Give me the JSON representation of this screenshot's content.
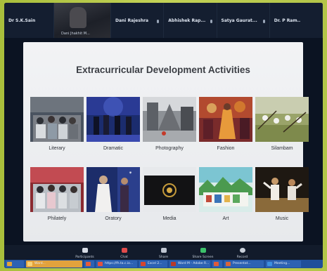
{
  "participants": [
    {
      "name": "Dr S.K.Sain",
      "sub": ""
    },
    {
      "name": "",
      "sub": "Dani Jhakhit M..."
    },
    {
      "name": "Dani Rajeshra",
      "sub": ""
    },
    {
      "name": "Abhishek Rap...",
      "sub": ""
    },
    {
      "name": "Satya Gaurat...",
      "sub": ""
    },
    {
      "name": "Dr. P Ram..",
      "sub": ""
    }
  ],
  "slide": {
    "title": "Extracurricular Development Activities",
    "activities": [
      {
        "label": "Literary"
      },
      {
        "label": "Dramatic"
      },
      {
        "label": "Photography"
      },
      {
        "label": "Fashion"
      },
      {
        "label": "Silambam"
      },
      {
        "label": "Philately"
      },
      {
        "label": "Oratory"
      },
      {
        "label": "Media"
      },
      {
        "label": "Art"
      },
      {
        "label": "Music"
      }
    ]
  },
  "toolbar": [
    {
      "label": "Participants",
      "icon": "participants-icon",
      "color": "#d7dce4"
    },
    {
      "label": "Chat",
      "icon": "chat-icon",
      "color": "#e04b4b"
    },
    {
      "label": "Share",
      "icon": "share-icon",
      "color": "#bfc6d1"
    },
    {
      "label": "Share Screen",
      "icon": "share-screen-icon",
      "color": "#3cc16a"
    },
    {
      "label": "Record",
      "icon": "record-icon",
      "color": "#c9d0da"
    }
  ],
  "taskbar": [
    {
      "label": "",
      "icon": "start-icon",
      "color": "#e0a23a"
    },
    {
      "label": "Ward...",
      "icon": "window-icon",
      "color": "#f0b84a"
    },
    {
      "label": "",
      "icon": "app-icon",
      "color": "#e45b3a"
    },
    {
      "label": "https://fh.ta.c.io...",
      "icon": "browser-icon",
      "color": "#e2523f"
    },
    {
      "label": "Excel 2...",
      "icon": "excel-icon",
      "color": "#d5452f"
    },
    {
      "label": "Ward M - Adobe R...",
      "icon": "adobe-icon",
      "color": "#b83a2a"
    },
    {
      "label": "",
      "icon": "app-icon",
      "color": "#e05a3a"
    },
    {
      "label": "Presentat...",
      "icon": "powerpoint-icon",
      "color": "#d8643a"
    },
    {
      "label": "Meeting...",
      "icon": "zoom-icon",
      "color": "#3d8fe0"
    }
  ]
}
